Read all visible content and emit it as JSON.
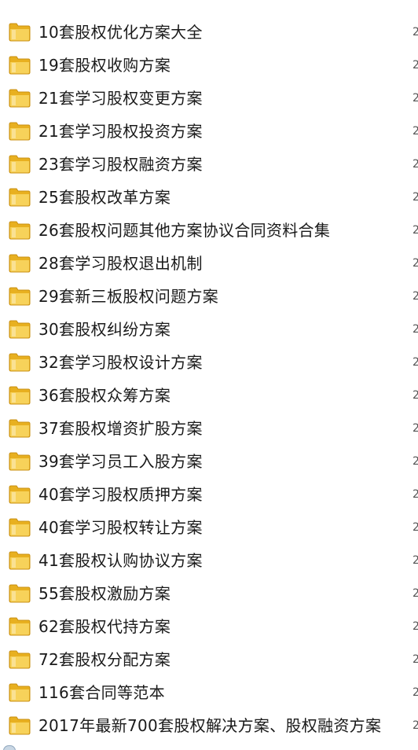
{
  "folders": [
    {
      "name": "10套股权优化方案大全"
    },
    {
      "name": "19套股权收购方案"
    },
    {
      "name": "21套学习股权变更方案"
    },
    {
      "name": "21套学习股权投资方案"
    },
    {
      "name": "23套学习股权融资方案"
    },
    {
      "name": "25套股权改革方案"
    },
    {
      "name": "26套股权问题其他方案协议合同资料合集"
    },
    {
      "name": "28套学习股权退出机制"
    },
    {
      "name": "29套新三板股权问题方案"
    },
    {
      "name": "30套股权纠纷方案"
    },
    {
      "name": "32套学习股权设计方案"
    },
    {
      "name": "36套股权众筹方案"
    },
    {
      "name": "37套股权增资扩股方案"
    },
    {
      "name": "39套学习员工入股方案"
    },
    {
      "name": "40套学习股权质押方案"
    },
    {
      "name": "40套学习股权转让方案"
    },
    {
      "name": "41套股权认购协议方案"
    },
    {
      "name": "55套股权激励方案"
    },
    {
      "name": "62套股权代持方案"
    },
    {
      "name": "72套股权分配方案"
    },
    {
      "name": "116套合同等范本"
    },
    {
      "name": "2017年最新700套股权解决方案、股权融资方案"
    }
  ],
  "column_edge_text": "2",
  "colors": {
    "folder_back": "#e8b020",
    "folder_front": "#f7d25a",
    "folder_edge": "#c98f10"
  }
}
